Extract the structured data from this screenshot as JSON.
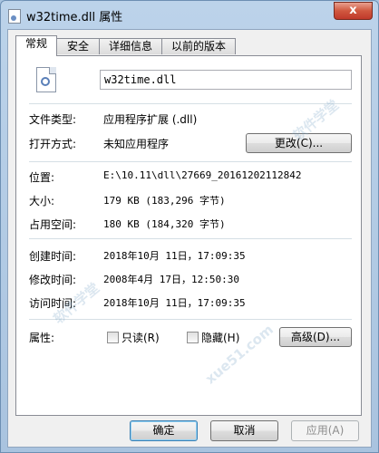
{
  "window": {
    "title": "w32time.dll 属性",
    "close_glyph": "x"
  },
  "tabs": [
    {
      "label": "常规"
    },
    {
      "label": "安全"
    },
    {
      "label": "详细信息"
    },
    {
      "label": "以前的版本"
    }
  ],
  "general": {
    "file_name": "w32time.dll",
    "file_type_label": "文件类型:",
    "file_type_value": "应用程序扩展 (.dll)",
    "opens_with_label": "打开方式:",
    "opens_with_value": "未知应用程序",
    "change_button": "更改(C)...",
    "location_label": "位置:",
    "location_value": "E:\\10.11\\dll\\27669_20161202112842",
    "size_label": "大小:",
    "size_value": "179 KB (183,296 字节)",
    "size_on_disk_label": "占用空间:",
    "size_on_disk_value": "180 KB (184,320 字节)",
    "created_label": "创建时间:",
    "created_value": "2018年10月 11日，17:09:35",
    "modified_label": "修改时间:",
    "modified_value": "2008年4月 17日，12:50:30",
    "accessed_label": "访问时间:",
    "accessed_value": "2018年10月 11日，17:09:35",
    "attributes_label": "属性:",
    "readonly_label": "只读(R)",
    "hidden_label": "隐藏(H)",
    "advanced_button": "高级(D)..."
  },
  "footer": {
    "ok_button": "确定",
    "cancel_button": "取消",
    "apply_button": "应用(A)"
  },
  "watermark": {
    "text1": "软件学堂",
    "text2": "xue51.com"
  },
  "colors": {
    "close": "#c0392b",
    "window_frame": "#a9c4e0",
    "panel": "#ffffff"
  }
}
